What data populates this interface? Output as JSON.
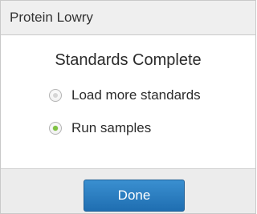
{
  "dialog": {
    "title": "Protein Lowry",
    "heading": "Standards Complete",
    "options": [
      {
        "label": "Load more standards",
        "selected": false
      },
      {
        "label": "Run samples",
        "selected": true
      }
    ],
    "done_label": "Done"
  },
  "colors": {
    "accent": "#2a7cc0",
    "radio_selected": "#7fc241"
  }
}
